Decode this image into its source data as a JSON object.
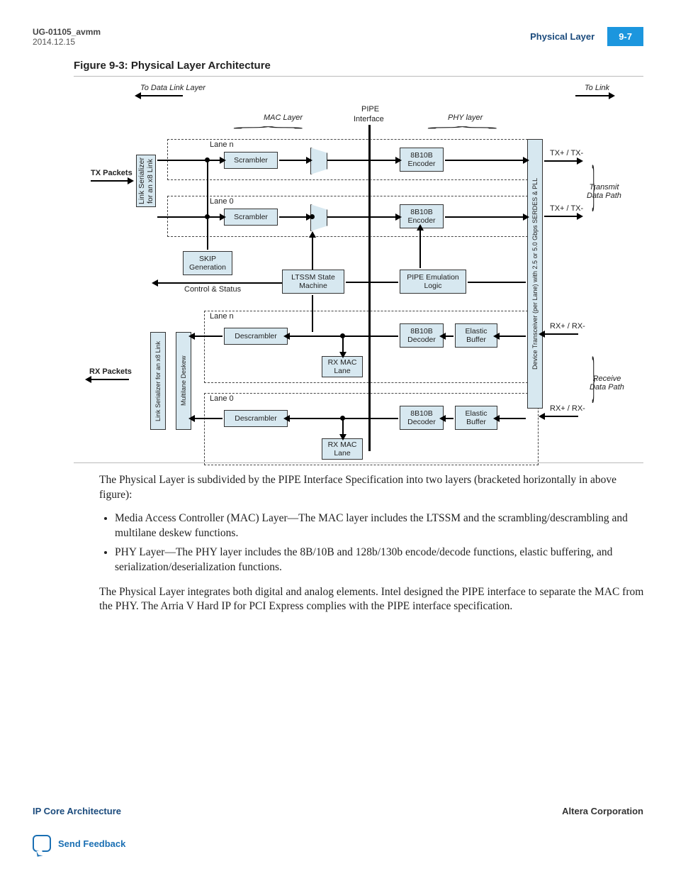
{
  "header": {
    "doc_id": "UG-01105_avmm",
    "date": "2014.12.15",
    "section": "Physical Layer",
    "page": "9-7"
  },
  "figure": {
    "title": "Figure 9-3: Physical Layer Architecture",
    "labels": {
      "to_dll": "To Data Link Layer",
      "to_link": "To Link",
      "mac_layer": "MAC Layer",
      "pipe_if_top": "PIPE",
      "pipe_if_bot": "Interface",
      "phy_layer": "PHY layer",
      "tx_packets": "TX Packets",
      "rx_packets": "RX Packets",
      "lane_n": "Lane n",
      "lane_0": "Lane 0",
      "ctrl_status": "Control & Status",
      "tx_path": "Transmit\nData Path",
      "rx_path": "Receive\nData Path",
      "txp": "TX+ / TX-",
      "rxp": "RX+ / RX-"
    },
    "boxes": {
      "link_ser_tx": "Link Serializer\nfor an x8 Link",
      "link_ser_rx": "Link Serializer for an x8 Link",
      "multilane_deskew": "Multilane Deskew",
      "scrambler": "Scrambler",
      "descrambler": "Descrambler",
      "skip_gen": "SKIP\nGeneration",
      "ltssm": "LTSSM\nState Machine",
      "enc8b10b": "8B10B\nEncoder",
      "dec8b10b": "8B10B\nDecoder",
      "pipe_emu": "PIPE\nEmulation Logic",
      "elastic": "Elastic\nBuffer",
      "rx_mac": "RX MAC\nLane",
      "xcvr": "Device Transceiver (per Lane) with 2.5 or 5.0  Gbps SERDES & PLL"
    }
  },
  "body": {
    "p1": "The Physical Layer is subdivided by the PIPE Interface Specification into two layers (bracketed horizontally in above figure):",
    "li1": "Media Access Controller (MAC) Layer—The MAC layer includes the LTSSM and the scrambling/descrambling and multilane deskew functions.",
    "li2": "PHY Layer—The PHY layer includes the 8B/10B and 128b/130b encode/decode functions, elastic buffering, and serialization/deserialization functions.",
    "p2": "The Physical Layer integrates both digital and analog elements. Intel designed the PIPE interface to separate the MAC from the PHY. The Arria V Hard IP for PCI Express complies with the PIPE interface specification."
  },
  "footer": {
    "left": "IP Core Architecture",
    "right": "Altera Corporation",
    "feedback": "Send Feedback"
  }
}
